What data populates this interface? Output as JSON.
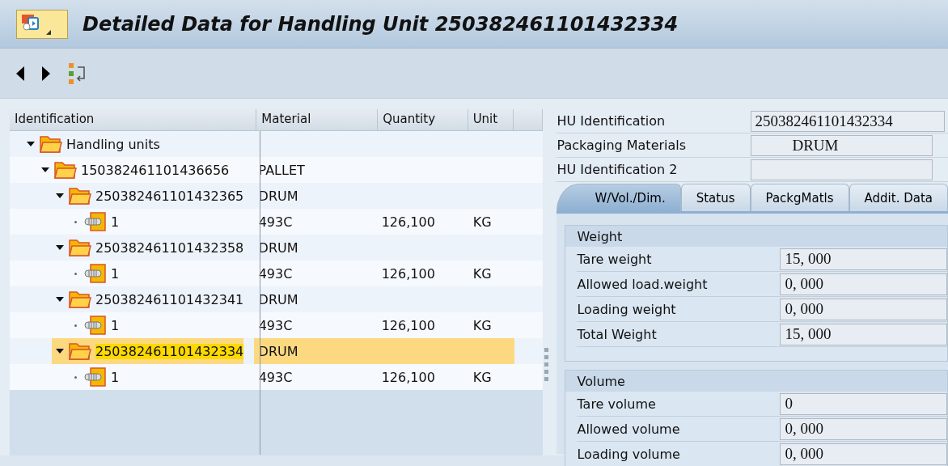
{
  "window": {
    "title": "Detailed Data for Handling Unit 250382461101432334"
  },
  "tree": {
    "columns": [
      "Identification",
      "Material",
      "Quantity",
      "Unit"
    ],
    "nodes": [
      {
        "kind": "folder",
        "label": "Handling units",
        "expanded": true,
        "selected": false,
        "children": [
          {
            "kind": "folder",
            "label": "150382461101436656",
            "material": "PALLET",
            "expanded": true,
            "selected": false,
            "children": [
              {
                "kind": "folder",
                "label": "250382461101432365",
                "material": "DRUM",
                "expanded": true,
                "selected": false,
                "children": [
                  {
                    "kind": "item",
                    "label": "1",
                    "material": "493C",
                    "quantity": "126,100",
                    "unit": "KG",
                    "selected": false
                  }
                ]
              },
              {
                "kind": "folder",
                "label": "250382461101432358",
                "material": "DRUM",
                "expanded": true,
                "selected": false,
                "children": [
                  {
                    "kind": "item",
                    "label": "1",
                    "material": "493C",
                    "quantity": "126,100",
                    "unit": "KG",
                    "selected": false
                  }
                ]
              },
              {
                "kind": "folder",
                "label": "250382461101432341",
                "material": "DRUM",
                "expanded": true,
                "selected": false,
                "children": [
                  {
                    "kind": "item",
                    "label": "1",
                    "material": "493C",
                    "quantity": "126,100",
                    "unit": "KG",
                    "selected": false
                  }
                ]
              },
              {
                "kind": "folder",
                "label": "250382461101432334",
                "material": "DRUM",
                "expanded": true,
                "selected": true,
                "children": [
                  {
                    "kind": "item",
                    "label": "1",
                    "material": "493C",
                    "quantity": "126,100",
                    "unit": "KG",
                    "selected": false
                  }
                ]
              }
            ]
          }
        ]
      }
    ]
  },
  "header_fields": [
    {
      "label": "HU Identification",
      "value": "250382461101432334"
    },
    {
      "label": "Packaging Materials",
      "value": "DRUM"
    },
    {
      "label": "HU Identification 2"
    }
  ],
  "tabs": [
    {
      "label": "W/Vol./Dim.",
      "selected": true
    },
    {
      "label": "Status",
      "selected": false
    },
    {
      "label": "PackgMatls",
      "selected": false
    },
    {
      "label": "Addit. Data",
      "selected": false
    }
  ],
  "groups": [
    {
      "title": "Weight",
      "fields": [
        {
          "label": "Tare weight",
          "value": "15, 000"
        },
        {
          "label": "Allowed load.weight",
          "value": "0, 000"
        },
        {
          "label": "Loading weight",
          "value": "0, 000"
        },
        {
          "label": "Total Weight",
          "value": "15, 000"
        }
      ]
    },
    {
      "title": "Volume",
      "fields": [
        {
          "label": "Tare volume",
          "value": "0"
        },
        {
          "label": "Allowed volume",
          "value": "0, 000"
        },
        {
          "label": "Loading volume",
          "value": "0, 000"
        }
      ]
    }
  ]
}
